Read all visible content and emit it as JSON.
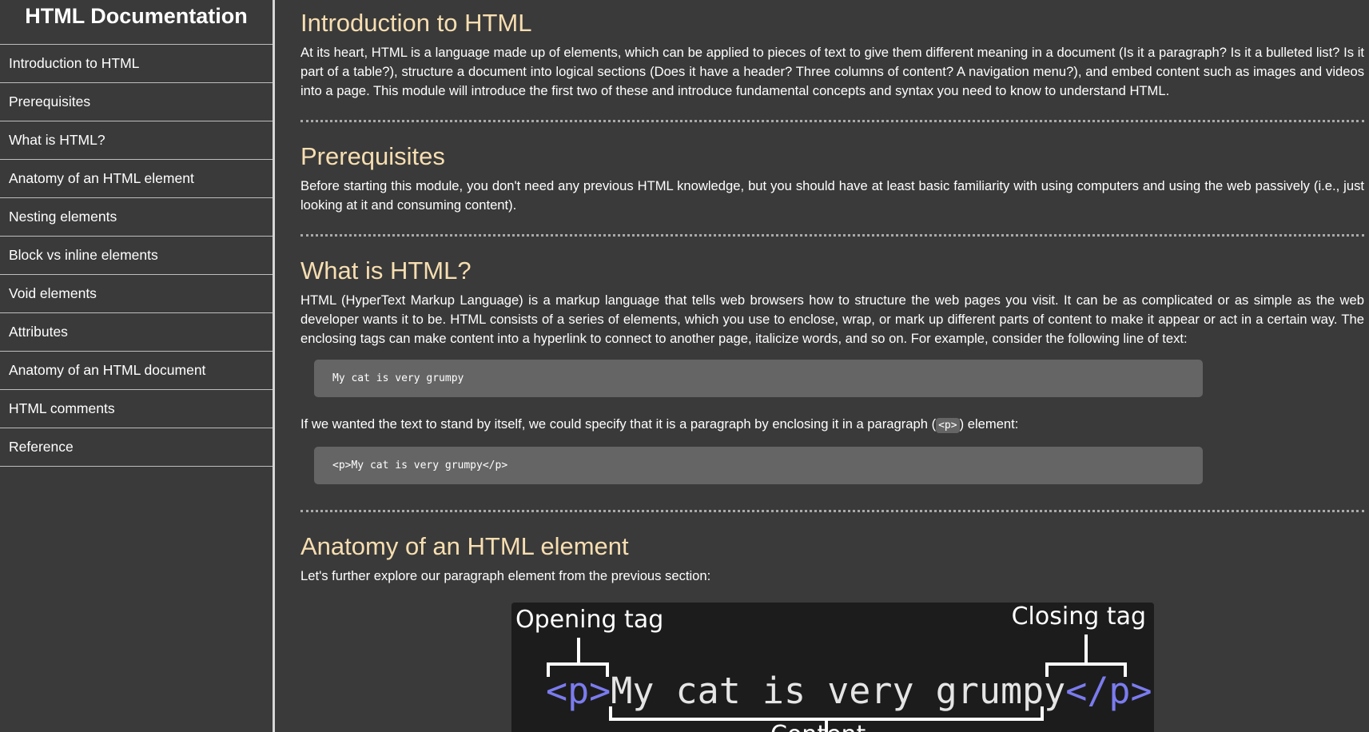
{
  "sidebar": {
    "title": "HTML Documentation",
    "items": [
      {
        "label": "Introduction to HTML"
      },
      {
        "label": "Prerequisites"
      },
      {
        "label": "What is HTML?"
      },
      {
        "label": "Anatomy of an HTML element"
      },
      {
        "label": "Nesting elements"
      },
      {
        "label": "Block vs inline elements"
      },
      {
        "label": "Void elements"
      },
      {
        "label": "Attributes"
      },
      {
        "label": "Anatomy of an HTML document"
      },
      {
        "label": "HTML comments"
      },
      {
        "label": "Reference"
      }
    ]
  },
  "sections": {
    "intro": {
      "heading": "Introduction to HTML",
      "body": "At its heart, HTML is a language made up of elements, which can be applied to pieces of text to give them different meaning in a document (Is it a paragraph? Is it a bulleted list? Is it part of a table?), structure a document into logical sections (Does it have a header? Three columns of content? A navigation menu?), and embed content such as images and videos into a page. This module will introduce the first two of these and introduce fundamental concepts and syntax you need to know to understand HTML."
    },
    "prereq": {
      "heading": "Prerequisites",
      "body": "Before starting this module, you don't need any previous HTML knowledge, but you should have at least basic familiarity with using computers and using the web passively (i.e., just looking at it and consuming content)."
    },
    "what": {
      "heading": "What is HTML?",
      "body": "HTML (HyperText Markup Language) is a markup language that tells web browsers how to structure the web pages you visit. It can be as complicated or as simple as the web developer wants it to be. HTML consists of a series of elements, which you use to enclose, wrap, or mark up different parts of content to make it appear or act in a certain way. The enclosing tags can make content into a hyperlink to connect to another page, italicize words, and so on. For example, consider the following line of text:",
      "code1": "My cat is very grumpy",
      "para2_before": "If we wanted the text to stand by itself, we could specify that it is a paragraph by enclosing it in a paragraph (",
      "para2_code": "<p>",
      "para2_after": ") element:",
      "code2": "<p>My cat is very grumpy</p>"
    },
    "anatomy": {
      "heading": "Anatomy of an HTML element",
      "body": "Let's further explore our paragraph element from the previous section:"
    }
  },
  "diagram": {
    "opening_label": "Opening tag",
    "closing_label": "Closing tag",
    "open_tag": "<p>",
    "content_text": "My cat is very grumpy",
    "close_tag": "</p>",
    "content_label": "Content",
    "tag_color": "#7b7bef"
  }
}
